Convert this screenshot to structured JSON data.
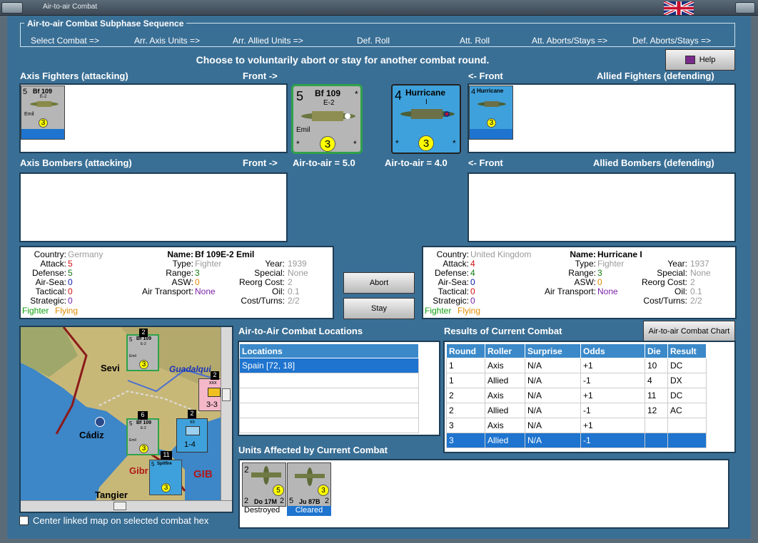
{
  "window": {
    "title": "Air-to-air Combat"
  },
  "subphase": {
    "legend": "Air-to-air Combat Subphase Sequence",
    "steps": [
      "Select Combat =>",
      "Arr. Axis Units =>",
      "Arr. Allied Units =>",
      "Def. Roll",
      "Att. Roll",
      "Att. Aborts/Stays =>",
      "Def. Aborts/Stays =>"
    ]
  },
  "instruction": "Choose to voluntarily abort or stay for another combat round.",
  "help_label": "Help",
  "axis_fighters_label": "Axis Fighters (attacking)",
  "front_right": "Front ->",
  "front_left": "<- Front",
  "allied_fighters_label": "Allied Fighters (defending)",
  "axis_bombers_label": "Axis Bombers (attacking)",
  "allied_bombers_label": "Allied Bombers (defending)",
  "axis_counter": {
    "attack": "5",
    "name": "Bf 109",
    "model": "E-2",
    "nick": "Emil",
    "rating": "3",
    "star": "*"
  },
  "allied_counter": {
    "attack": "4",
    "name": "Hurricane",
    "model": "I",
    "rating": "3",
    "star": "*"
  },
  "axis_air_to_air": "Air-to-air = 5.0",
  "allied_air_to_air": "Air-to-air = 4.0",
  "axis_info": {
    "country_label": "Country:",
    "country": "Germany",
    "attack_label": "Attack:",
    "attack": "5",
    "defense_label": "Defense:",
    "defense": "5",
    "airsea_label": "Air-Sea:",
    "airsea": "0",
    "tactical_label": "Tactical:",
    "tactical": "0",
    "strategic_label": "Strategic:",
    "strategic": "0",
    "role": "Fighter",
    "status": "Flying",
    "name_label": "Name:",
    "name": "Bf 109E-2 Emil",
    "type_label": "Type:",
    "type": "Fighter",
    "range_label": "Range:",
    "range": "3",
    "asw_label": "ASW:",
    "asw": "0",
    "airtransport_label": "Air Transport:",
    "airtransport": "None",
    "year_label": "Year:",
    "year": "1939",
    "special_label": "Special:",
    "special": "None",
    "reorg_label": "Reorg Cost:",
    "reorg": "2",
    "oil_label": "Oil:",
    "oil": "0.1",
    "costturns_label": "Cost/Turns:",
    "costturns": "2/2"
  },
  "allied_info": {
    "country_label": "Country:",
    "country": "United Kingdom",
    "attack_label": "Attack:",
    "attack": "4",
    "defense_label": "Defense:",
    "defense": "4",
    "airsea_label": "Air-Sea:",
    "airsea": "0",
    "tactical_label": "Tactical:",
    "tactical": "0",
    "strategic_label": "Strategic:",
    "strategic": "0",
    "role": "Fighter",
    "status": "Flying",
    "name_label": "Name:",
    "name": "Hurricane I",
    "type_label": "Type:",
    "type": "Fighter",
    "range_label": "Range:",
    "range": "3",
    "asw_label": "ASW:",
    "asw": "0",
    "airtransport_label": "Air Transport:",
    "airtransport": "None",
    "year_label": "Year:",
    "year": "1937",
    "special_label": "Special:",
    "special": "None",
    "reorg_label": "Reorg Cost:",
    "reorg": "2",
    "oil_label": "Oil:",
    "oil": "0.1",
    "costturns_label": "Cost/Turns:",
    "costturns": "2/2"
  },
  "abort_label": "Abort",
  "stay_label": "Stay",
  "locations_title": "Air-to-Air Combat Locations",
  "locations_header": "Locations",
  "locations": [
    "Spain [72, 18]"
  ],
  "results_title": "Results of Current Combat",
  "chart_button": "Air-to-air Combat Chart",
  "results_headers": [
    "Round",
    "Roller",
    "Surprise",
    "Odds",
    "Die",
    "Result"
  ],
  "results_rows": [
    [
      "1",
      "Axis",
      "N/A",
      "+1",
      "10",
      "DC"
    ],
    [
      "1",
      "Allied",
      "N/A",
      "-1",
      "4",
      "DX"
    ],
    [
      "2",
      "Axis",
      "N/A",
      "+1",
      "11",
      "DC"
    ],
    [
      "2",
      "Allied",
      "N/A",
      "-1",
      "12",
      "AC"
    ],
    [
      "3",
      "Axis",
      "N/A",
      "+1",
      "",
      ""
    ],
    [
      "3",
      "Allied",
      "N/A",
      "-1",
      "",
      ""
    ]
  ],
  "units_affected_title": "Units Affected by Current Combat",
  "affected": [
    {
      "left": "2",
      "right": "2",
      "name": "Do 17M",
      "rating": "5",
      "status": "Destroyed"
    },
    {
      "left": "5",
      "right": "2",
      "name": "Ju 87B",
      "rating": "3",
      "status": "Cleared"
    }
  ],
  "map": {
    "cities": [
      "Sevi",
      "Cádiz",
      "Tangier",
      "Gibr",
      "GIB"
    ],
    "river": "Guadalqui",
    "stacks": [
      "2",
      "6",
      "11",
      "2",
      "2"
    ],
    "unit_xxx": "xxx",
    "unit_xxx_val": "3-3",
    "unit_xx": "xx",
    "unit_xx_val": "1-4",
    "mini_counters": [
      {
        "attack": "5",
        "name": "Bf 109",
        "model": "E-2",
        "nick": "Emil",
        "rating": "3"
      },
      {
        "attack": "5",
        "name": "Bf 109",
        "model": "E-2",
        "nick": "Emil",
        "rating": "3"
      },
      {
        "attack": "5",
        "name": "Spitfire",
        "model": "",
        "nick": "",
        "rating": "3"
      }
    ]
  },
  "center_map_label": "Center linked map on selected combat hex"
}
